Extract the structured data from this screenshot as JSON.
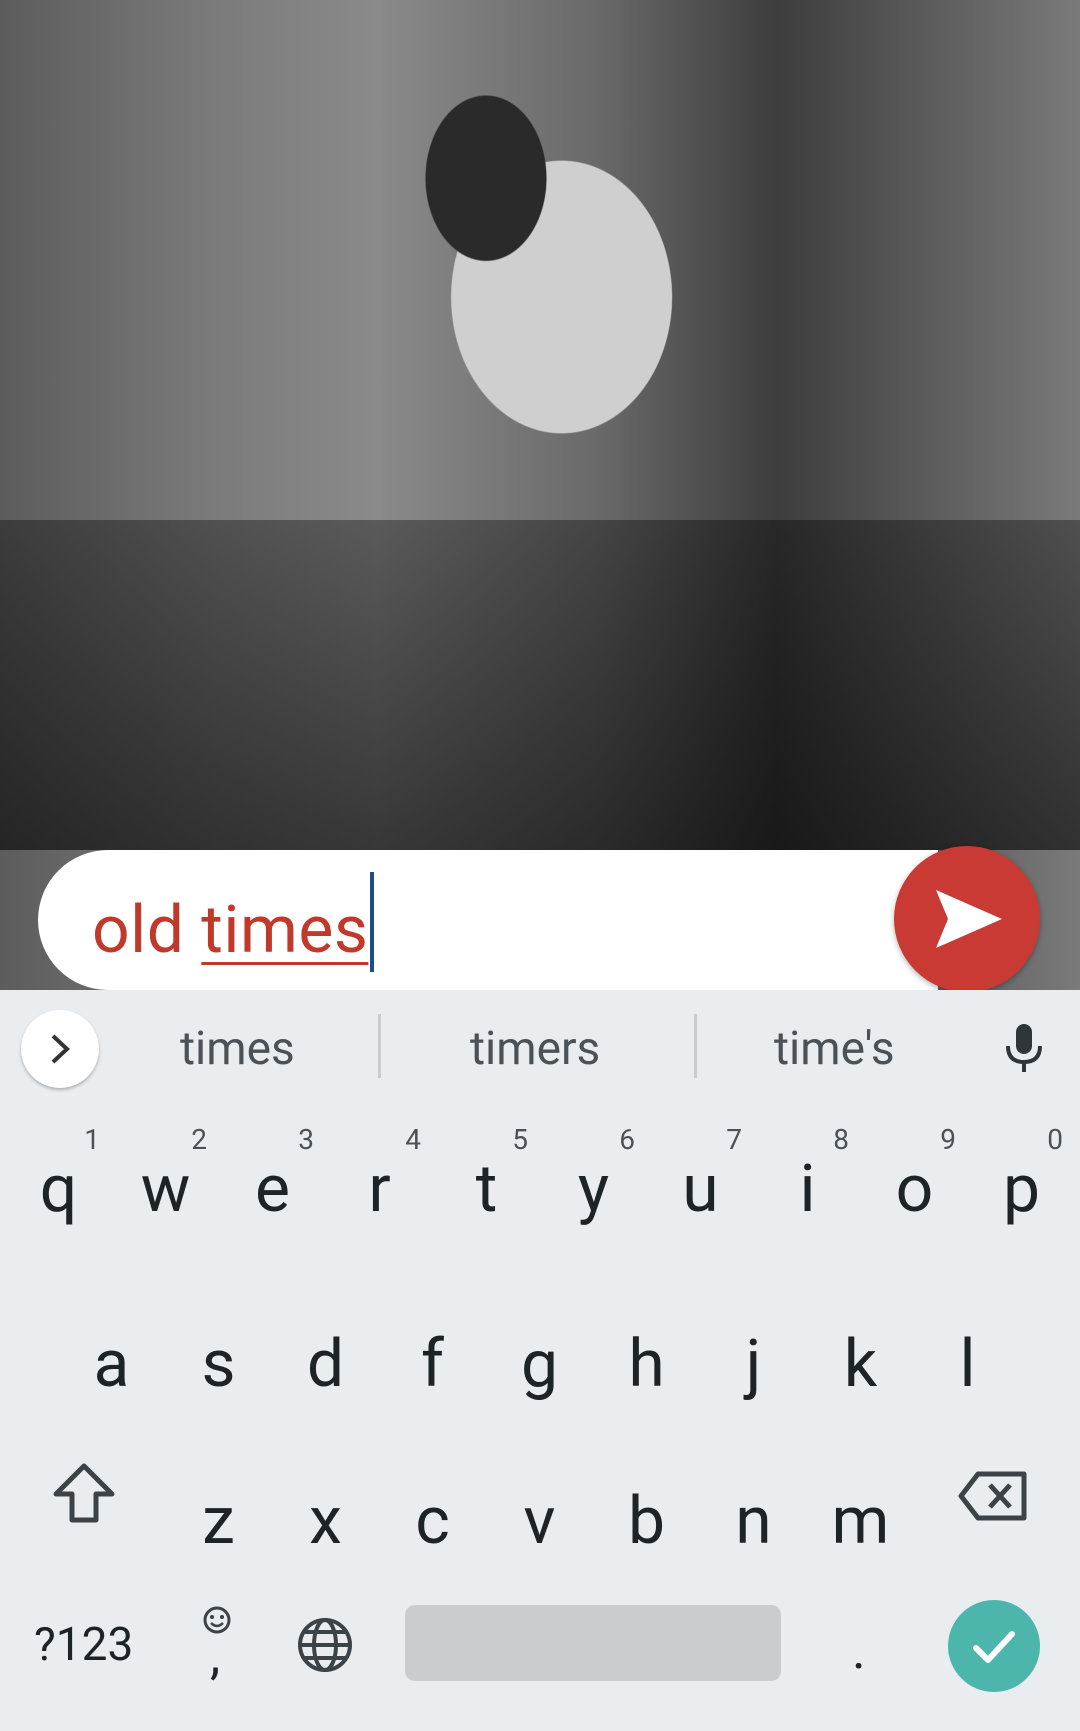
{
  "input": {
    "word1": "old ",
    "word2": "times"
  },
  "suggestions": [
    "times",
    "timers",
    "time's"
  ],
  "keyboard": {
    "row1": [
      {
        "ch": "q",
        "hint": "1"
      },
      {
        "ch": "w",
        "hint": "2"
      },
      {
        "ch": "e",
        "hint": "3"
      },
      {
        "ch": "r",
        "hint": "4"
      },
      {
        "ch": "t",
        "hint": "5"
      },
      {
        "ch": "y",
        "hint": "6"
      },
      {
        "ch": "u",
        "hint": "7"
      },
      {
        "ch": "i",
        "hint": "8"
      },
      {
        "ch": "o",
        "hint": "9"
      },
      {
        "ch": "p",
        "hint": "0"
      }
    ],
    "row2": [
      "a",
      "s",
      "d",
      "f",
      "g",
      "h",
      "j",
      "k",
      "l"
    ],
    "row3": [
      "z",
      "x",
      "c",
      "v",
      "b",
      "n",
      "m"
    ],
    "symbols_label": "?123",
    "comma": ",",
    "period": "."
  },
  "colors": {
    "accent_red": "#c93a34",
    "enter_teal": "#4db6ac"
  },
  "icons": [
    "send-icon",
    "chevron-right-icon",
    "microphone-icon",
    "shift-icon",
    "backspace-icon",
    "emoji-icon",
    "globe-icon",
    "check-icon"
  ]
}
